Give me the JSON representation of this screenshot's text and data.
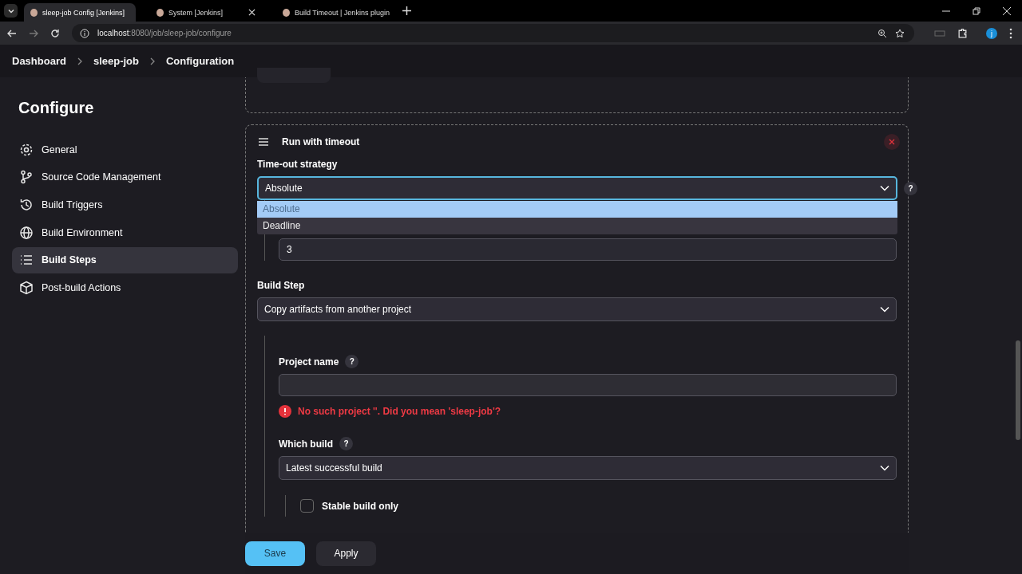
{
  "browser": {
    "tabs": [
      {
        "title": "sleep-job Config [Jenkins]",
        "selected": true
      },
      {
        "title": "System [Jenkins]",
        "selected": false
      },
      {
        "title": "Build Timeout | Jenkins plugin",
        "selected": false
      }
    ],
    "url": {
      "host": "localhost",
      "path": ":8080/job/sleep-job/configure"
    },
    "profile_initial": "j"
  },
  "breadcrumb": [
    "Dashboard",
    "sleep-job",
    "Configuration"
  ],
  "sidebar": {
    "title": "Configure",
    "items": [
      {
        "label": "General",
        "selected": false
      },
      {
        "label": "Source Code Management",
        "selected": false
      },
      {
        "label": "Build Triggers",
        "selected": false
      },
      {
        "label": "Build Environment",
        "selected": false
      },
      {
        "label": "Build Steps",
        "selected": true
      },
      {
        "label": "Post-build Actions",
        "selected": false
      }
    ]
  },
  "timeout_section": {
    "title": "Run with timeout",
    "strategy_label": "Time-out strategy",
    "strategy_value": "Absolute",
    "strategy_help": "?",
    "dropdown_open": true,
    "options": [
      {
        "label": "Absolute",
        "selected": true
      },
      {
        "label": "Deadline",
        "selected": false
      }
    ],
    "timeout_value": "3"
  },
  "build_step": {
    "label": "Build Step",
    "value": "Copy artifacts from another project",
    "project_name_label": "Project name",
    "project_name_help": "?",
    "project_error": "No such project ''. Did you mean 'sleep-job'?",
    "which_build_label": "Which build",
    "which_build_help": "?",
    "which_build_value": "Latest successful build",
    "stable_build_only": {
      "label": "Stable build only",
      "checked": false
    }
  },
  "buttons": {
    "save": "Save",
    "apply": "Apply"
  }
}
